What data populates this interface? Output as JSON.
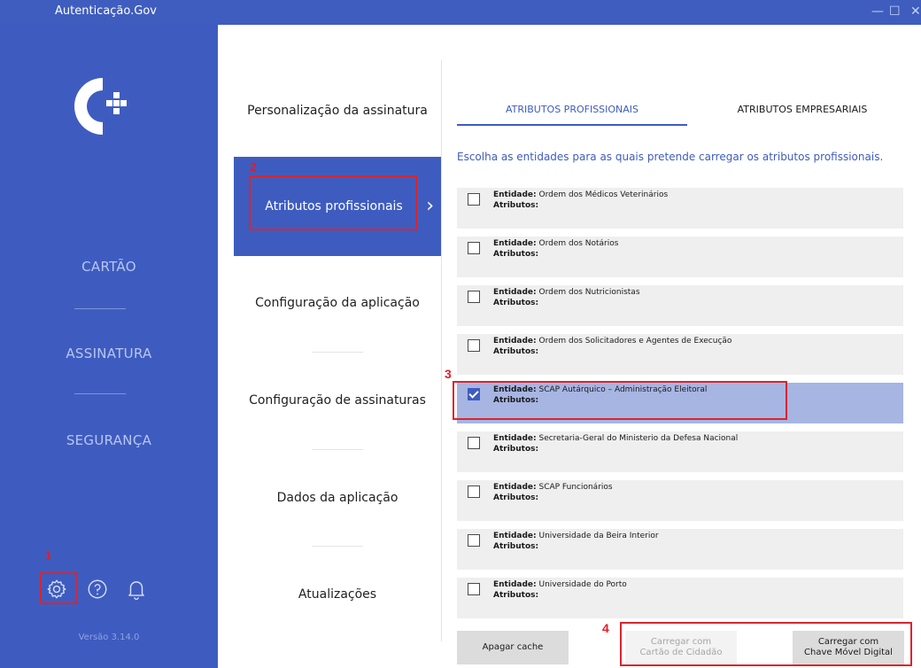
{
  "window": {
    "title": "Autenticação.Gov",
    "minimize": "—",
    "maximize": "☐",
    "close": "✕"
  },
  "sidebar": {
    "items": [
      {
        "label": "CARTÃO"
      },
      {
        "label": "ASSINATURA"
      },
      {
        "label": "SEGURANÇA"
      }
    ],
    "icons": [
      "gear-icon",
      "help-icon",
      "bell-icon"
    ],
    "version": "Versão 3.14.0"
  },
  "settings_menu": {
    "items": [
      {
        "label": "Personalização da assinatura"
      },
      {
        "label": "Atributos profissionais",
        "active": true
      },
      {
        "label": "Configuração da aplicação"
      },
      {
        "label": "Configuração de assinaturas"
      },
      {
        "label": "Dados da aplicação"
      },
      {
        "label": "Atualizações"
      }
    ]
  },
  "tabs": [
    {
      "label": "ATRIBUTOS PROFISSIONAIS",
      "active": true
    },
    {
      "label": "ATRIBUTOS EMPRESARIAIS",
      "active": false
    }
  ],
  "instruction": "Escolha as entidades para as quais pretende carregar os atributos profissionais.",
  "entity_label": "Entidade:",
  "attributes_label": "Atributos:",
  "entities": [
    {
      "name": "Ordem dos Médicos Veterinários",
      "checked": false
    },
    {
      "name": "Ordem dos Notários",
      "checked": false
    },
    {
      "name": "Ordem dos Nutricionistas",
      "checked": false
    },
    {
      "name": "Ordem dos Solicitadores e Agentes de Execução",
      "checked": false
    },
    {
      "name": "SCAP Autárquico – Administração Eleitoral",
      "checked": true
    },
    {
      "name": "Secretaria-Geral do Ministerio da Defesa Nacional",
      "checked": false
    },
    {
      "name": "SCAP Funcionários",
      "checked": false
    },
    {
      "name": "Universidade da Beira Interior",
      "checked": false
    },
    {
      "name": "Universidade do Porto",
      "checked": false
    }
  ],
  "buttons": {
    "clear_cache": "Apagar cache",
    "load_card_l1": "Carregar com",
    "load_card_l2": "Cartão de Cidadão",
    "load_cmd_l1": "Carregar com",
    "load_cmd_l2": "Chave Móvel Digital"
  },
  "annotations": [
    "1",
    "2",
    "3",
    "4"
  ],
  "colors": {
    "brand": "#3e5cc0",
    "annotation": "#d9252e",
    "selected_row": "#a7b5e3"
  }
}
